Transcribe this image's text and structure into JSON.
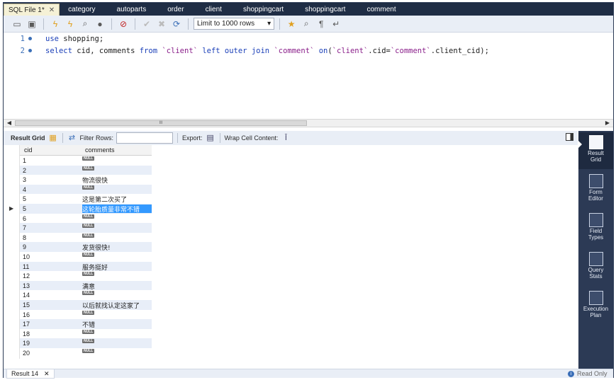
{
  "tabs": [
    {
      "label": "SQL File 1*",
      "active": true
    },
    {
      "label": "category"
    },
    {
      "label": "autoparts"
    },
    {
      "label": "order"
    },
    {
      "label": "client"
    },
    {
      "label": "shoppingcart"
    },
    {
      "label": "shoppingcart"
    },
    {
      "label": "comment"
    }
  ],
  "toolbar": {
    "limit_label": "Limit to 1000 rows",
    "icons": [
      "open-folder-icon",
      "save-icon",
      "execute-icon",
      "execute-current-icon",
      "explain-icon",
      "stop-icon",
      "error-icon",
      "commit-icon",
      "rollback-icon",
      "autocommit-icon",
      "beautify-icon",
      "find-icon",
      "invisible-chars-icon",
      "wrap-icon"
    ]
  },
  "editor": {
    "lines": [
      {
        "num": "1",
        "parts": [
          {
            "t": "use",
            "c": "kw"
          },
          {
            "t": " shopping;",
            "c": ""
          }
        ]
      },
      {
        "num": "2",
        "parts": [
          {
            "t": "select",
            "c": "kw"
          },
          {
            "t": " cid, comments ",
            "c": ""
          },
          {
            "t": "from",
            "c": "kw"
          },
          {
            "t": " ",
            "c": ""
          },
          {
            "t": "`client`",
            "c": "str"
          },
          {
            "t": " ",
            "c": ""
          },
          {
            "t": "left outer join",
            "c": "kw"
          },
          {
            "t": " ",
            "c": ""
          },
          {
            "t": "`comment`",
            "c": "str"
          },
          {
            "t": " ",
            "c": ""
          },
          {
            "t": "on",
            "c": "kw"
          },
          {
            "t": "(",
            "c": ""
          },
          {
            "t": "`client`",
            "c": "str"
          },
          {
            "t": ".cid=",
            "c": ""
          },
          {
            "t": "`comment`",
            "c": "str"
          },
          {
            "t": ".client_cid);",
            "c": ""
          }
        ]
      }
    ]
  },
  "scrollbar": {
    "thumb_grip": "III"
  },
  "result_toolbar": {
    "result_grid_label": "Result Grid",
    "filter_rows_label": "Filter Rows:",
    "filter_value": "",
    "export_label": "Export:",
    "wrap_label": "Wrap Cell Content:"
  },
  "grid": {
    "columns": [
      "cid",
      "comments"
    ],
    "null_text": "NULL",
    "selected_row_index": 5,
    "rows": [
      {
        "cid": "1",
        "comments": null
      },
      {
        "cid": "2",
        "comments": null
      },
      {
        "cid": "3",
        "comments": "物流很快"
      },
      {
        "cid": "4",
        "comments": null
      },
      {
        "cid": "5",
        "comments": "这是第二次买了"
      },
      {
        "cid": "5",
        "comments": "这轮胎质量非常不错"
      },
      {
        "cid": "6",
        "comments": null
      },
      {
        "cid": "7",
        "comments": null
      },
      {
        "cid": "8",
        "comments": null
      },
      {
        "cid": "9",
        "comments": "发货很快!"
      },
      {
        "cid": "10",
        "comments": null
      },
      {
        "cid": "11",
        "comments": "服务挺好"
      },
      {
        "cid": "12",
        "comments": null
      },
      {
        "cid": "13",
        "comments": "满意"
      },
      {
        "cid": "14",
        "comments": null
      },
      {
        "cid": "15",
        "comments": "以后就找认定这家了"
      },
      {
        "cid": "16",
        "comments": null
      },
      {
        "cid": "17",
        "comments": "不错"
      },
      {
        "cid": "18",
        "comments": null
      },
      {
        "cid": "19",
        "comments": null
      },
      {
        "cid": "20",
        "comments": null
      }
    ]
  },
  "side_panel": {
    "items": [
      {
        "label": "Result Grid",
        "active": true,
        "icon": "result-grid-icon"
      },
      {
        "label": "Form Editor",
        "icon": "form-editor-icon"
      },
      {
        "label": "Field Types",
        "icon": "field-types-icon"
      },
      {
        "label": "Query Stats",
        "icon": "query-stats-icon"
      },
      {
        "label": "Execution Plan",
        "icon": "execution-plan-icon"
      }
    ]
  },
  "bottom": {
    "result_tab": "Result 14",
    "readonly": "Read Only"
  },
  "colors": {
    "tabbar": "#1f2d45",
    "side_panel": "#2c3a55",
    "keyword": "#1a3fb8",
    "identifier": "#8a1f8a",
    "selection": "#3399ff",
    "row_alt": "#e8eef8"
  }
}
